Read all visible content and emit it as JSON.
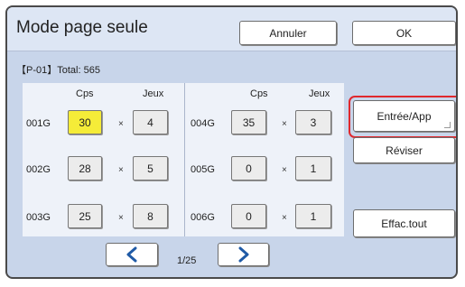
{
  "header": {
    "title": "Mode page seule",
    "cancel_label": "Annuler",
    "ok_label": "OK"
  },
  "total_label": "【P-01】Total: 565",
  "columns": {
    "left": {
      "cps_header": "Cps",
      "jeux_header": "Jeux"
    },
    "right": {
      "cps_header": "Cps",
      "jeux_header": "Jeux"
    }
  },
  "rows_left": [
    {
      "label": "001G",
      "cps": "30",
      "jeux": "4",
      "selected": true
    },
    {
      "label": "002G",
      "cps": "28",
      "jeux": "5",
      "selected": false
    },
    {
      "label": "003G",
      "cps": "25",
      "jeux": "8",
      "selected": false
    }
  ],
  "rows_right": [
    {
      "label": "004G",
      "cps": "35",
      "jeux": "3",
      "selected": false
    },
    {
      "label": "005G",
      "cps": "0",
      "jeux": "1",
      "selected": false
    },
    {
      "label": "006G",
      "cps": "0",
      "jeux": "1",
      "selected": false
    }
  ],
  "multiply_sign": "×",
  "side_buttons": {
    "entry_label": "Entrée/App",
    "review_label": "Réviser",
    "clear_label": "Effac.tout"
  },
  "pagination": {
    "current": "1/25",
    "prev_icon": "chevron-left-icon",
    "next_icon": "chevron-right-icon"
  },
  "colors": {
    "selected_cell": "#f5ec38",
    "highlight_ring": "#e0282d",
    "arrow": "#1f5aa6",
    "background": "#c8d5ea"
  }
}
